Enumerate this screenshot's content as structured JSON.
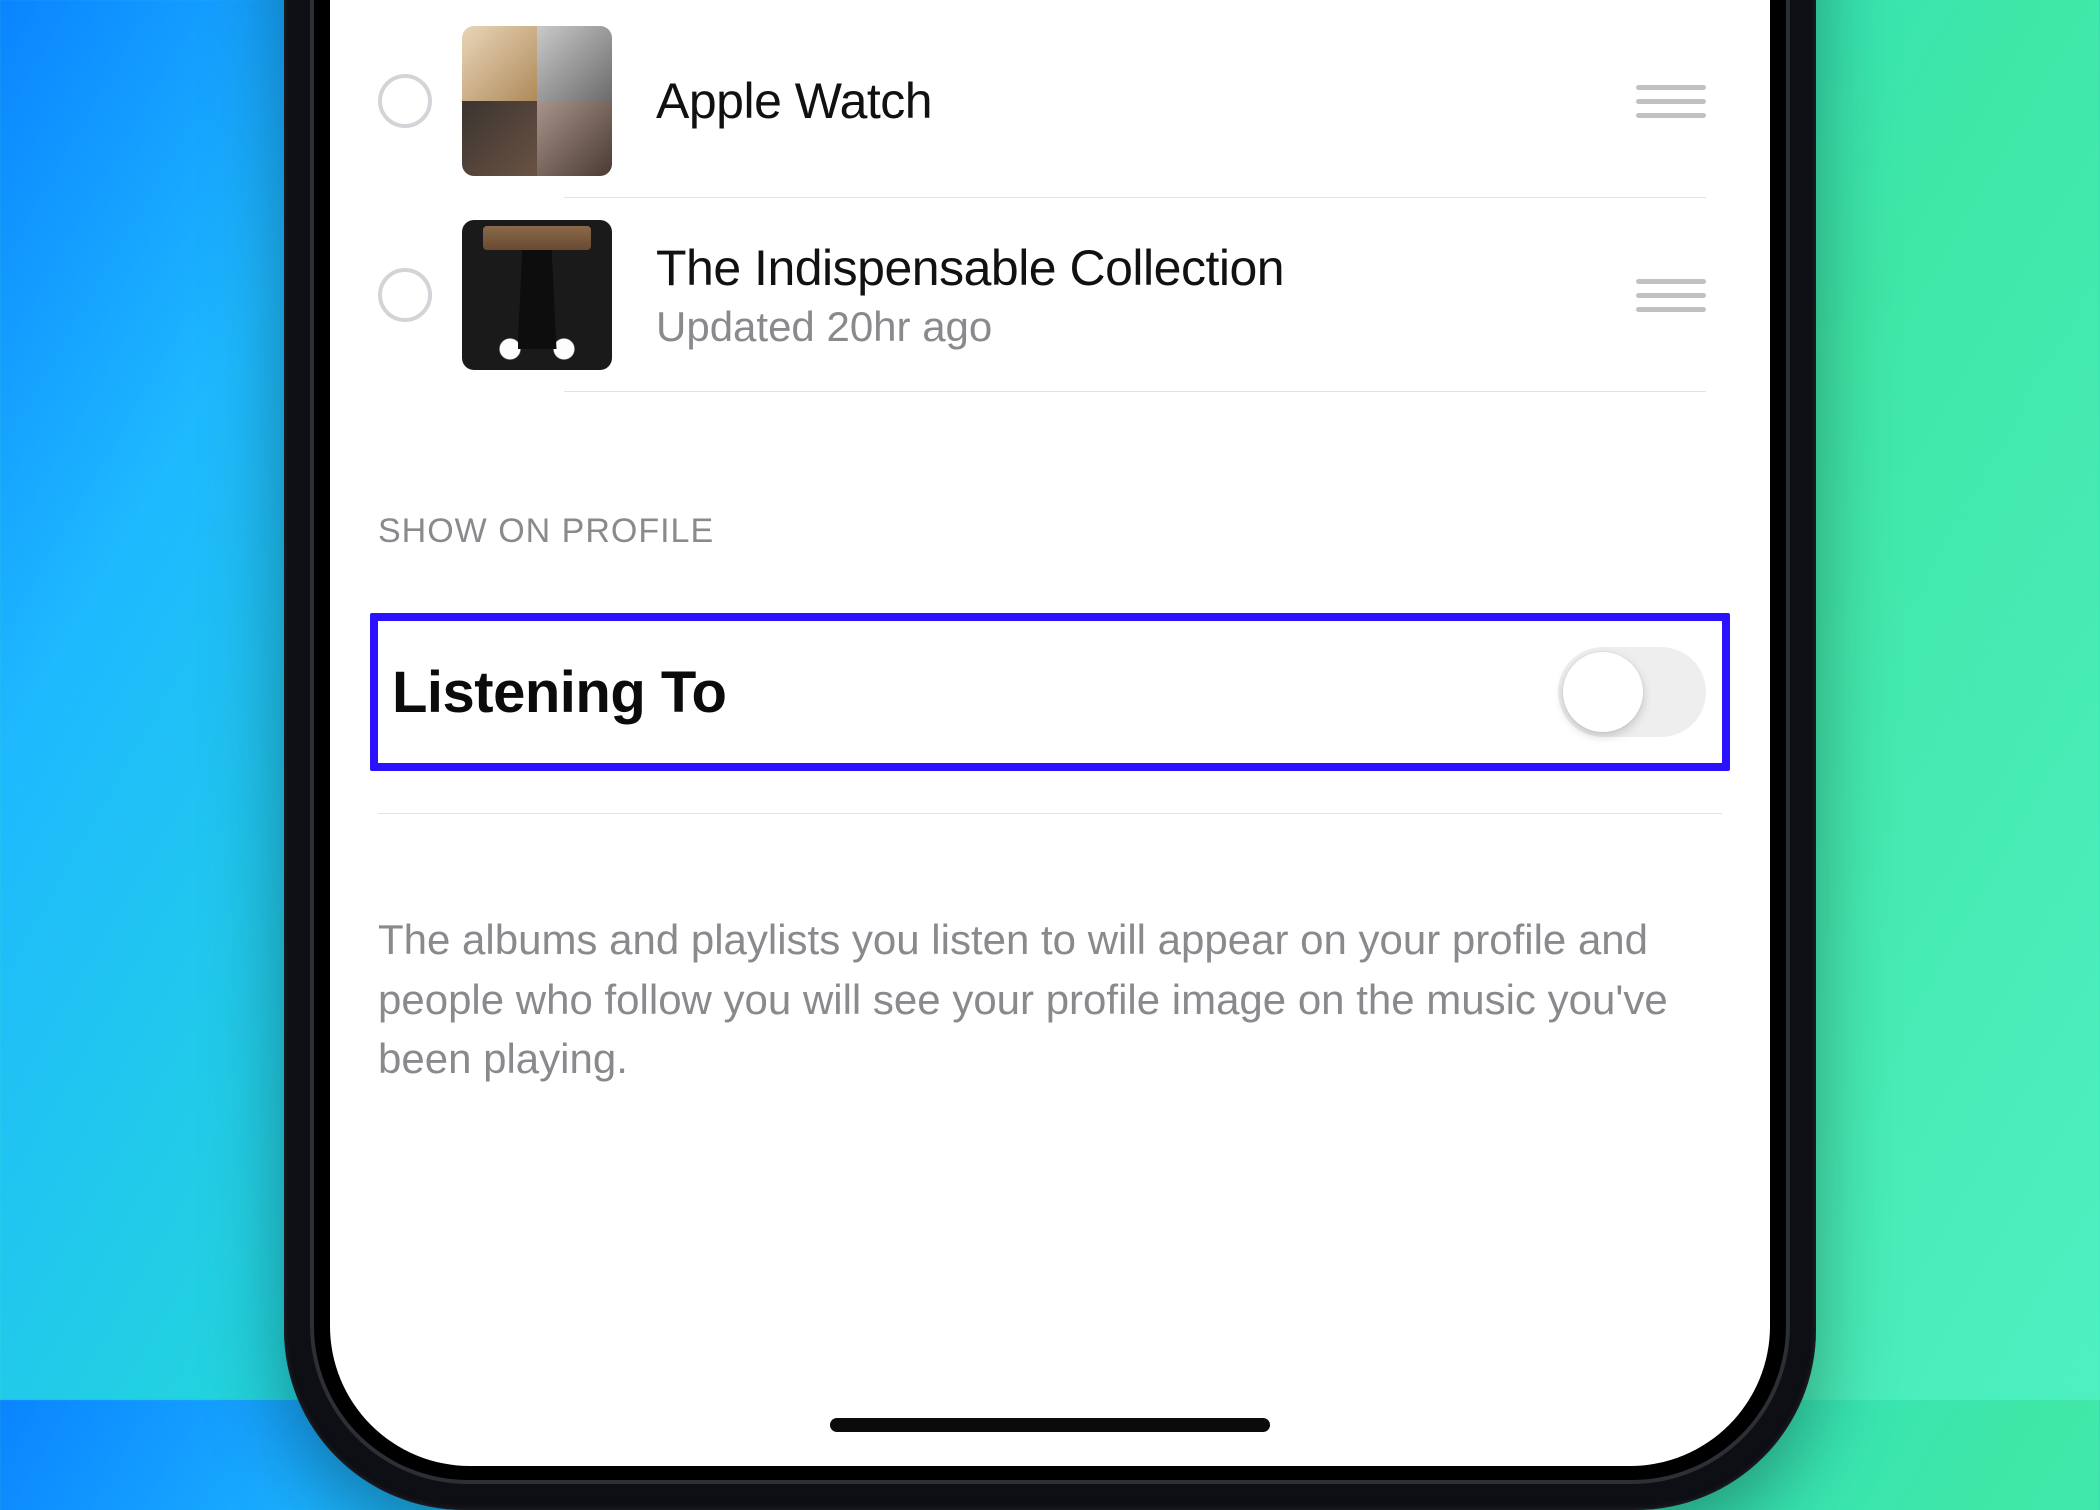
{
  "playlists": [
    {
      "title": "Apple Watch",
      "subtitle": ""
    },
    {
      "title": "The Indispensable Collection",
      "subtitle": "Updated 20hr ago"
    }
  ],
  "section_header": "SHOW ON PROFILE",
  "listening_to": {
    "label": "Listening To",
    "enabled": false
  },
  "description": "The albums and playlists you listen to will appear on your profile and people who follow you will see your profile image on the music you've been playing.",
  "highlight_color": "#2a12ff"
}
